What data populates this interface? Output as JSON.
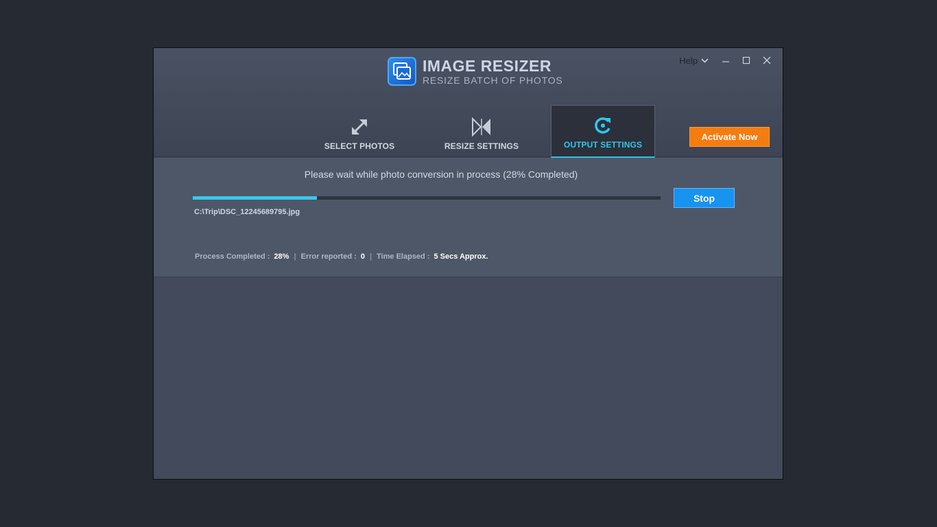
{
  "app": {
    "title": "IMAGE RESIZER",
    "subtitle": "RESIZE BATCH OF PHOTOS"
  },
  "window_controls": {
    "help_label": "Help",
    "icons": [
      "chevron-down-icon",
      "minimize-icon",
      "maximize-icon",
      "close-icon"
    ]
  },
  "tabs": [
    {
      "label": "SELECT PHOTOS",
      "icon": "expand-arrows-icon",
      "active": false
    },
    {
      "label": "RESIZE SETTINGS",
      "icon": "resize-bowtie-icon",
      "active": false
    },
    {
      "label": "OUTPUT SETTINGS",
      "icon": "refresh-icon",
      "active": true
    }
  ],
  "activate_label": "Activate Now",
  "progress": {
    "message": "Please wait while photo conversion in process  (28% Completed)",
    "fraction": 0.265,
    "current_file": "C:\\Trip\\DSC_12245689795.jpg",
    "stop_label": "Stop"
  },
  "stats": {
    "process_completed_label": "Process Completed :",
    "process_completed_value": "28%",
    "error_label": "Error reported :",
    "error_value": "0",
    "time_label": "Time Elapsed :",
    "time_value": "5 Secs  Approx."
  },
  "colors": {
    "accent": "#35c8ee",
    "activate": "#f57c0f",
    "stop": "#1793f0",
    "window_bg": "#424a5b",
    "desktop_bg": "#252a33"
  }
}
